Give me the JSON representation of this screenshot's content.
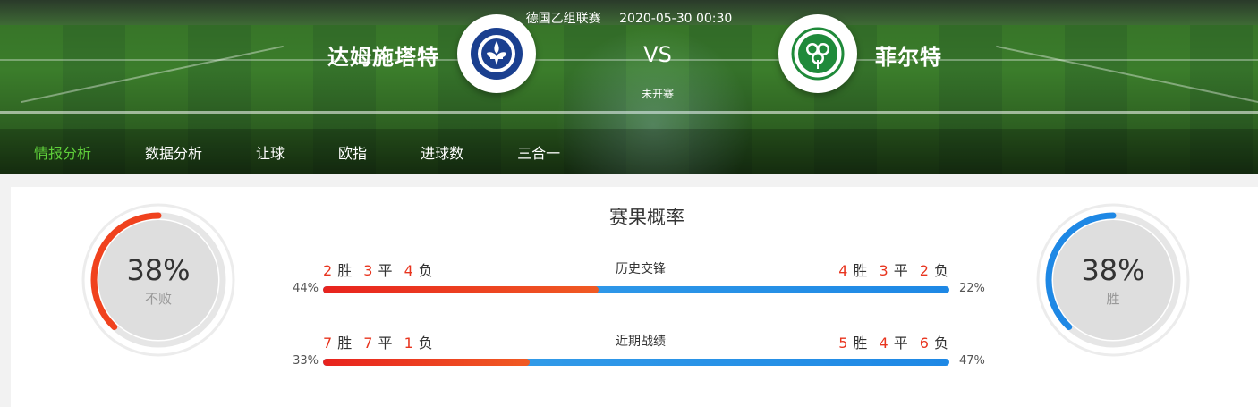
{
  "match": {
    "league": "德国乙组联赛",
    "datetime": "2020-05-30 00:30",
    "home_team": "达姆施塔特",
    "away_team": "菲尔特",
    "vs": "VS",
    "status": "未开赛"
  },
  "tabs": [
    {
      "label": "情报分析",
      "active": true
    },
    {
      "label": "数据分析",
      "active": false
    },
    {
      "label": "让球",
      "active": false
    },
    {
      "label": "欧指",
      "active": false
    },
    {
      "label": "进球数",
      "active": false
    },
    {
      "label": "三合一",
      "active": false
    }
  ],
  "panel": {
    "title": "赛果概率",
    "left_ring": {
      "pct": "38%",
      "label": "不败",
      "value": 0.38,
      "color": "#f0421e"
    },
    "right_ring": {
      "pct": "38%",
      "label": "胜",
      "value": 0.38,
      "color": "#1e88e5"
    },
    "rows": [
      {
        "label": "历史交锋",
        "left_record": {
          "w": "2",
          "d": "3",
          "l": "4"
        },
        "right_record": {
          "w": "4",
          "d": "3",
          "l": "2"
        },
        "left_pct": "44%",
        "right_pct": "22%",
        "split": 0.44
      },
      {
        "label": "近期战绩",
        "left_record": {
          "w": "7",
          "d": "7",
          "l": "1"
        },
        "right_record": {
          "w": "5",
          "d": "4",
          "l": "6"
        },
        "left_pct": "33%",
        "right_pct": "47%",
        "split": 0.33
      }
    ],
    "words": {
      "win": "胜",
      "draw": "平",
      "loss": "负"
    }
  },
  "icons": {
    "home_logo": "darmstadt-crest-icon",
    "away_logo": "clover-crest-icon"
  },
  "colors": {
    "accent": "#5fcf3a",
    "home": "#e8341e",
    "away": "#1e88e5"
  }
}
